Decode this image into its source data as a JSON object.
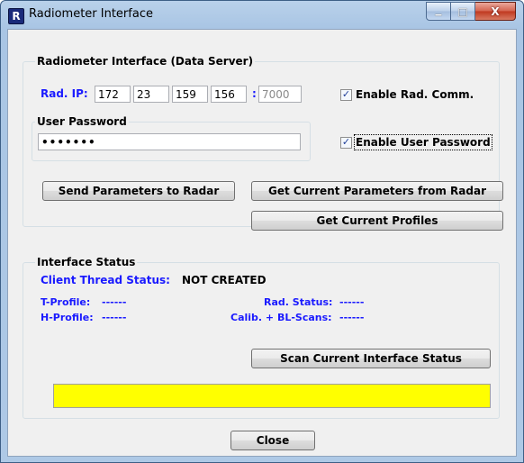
{
  "window": {
    "title": "Radiometer Interface",
    "icon_glyph": "R",
    "minimize_glyph": "▁",
    "maximize_glyph": "□",
    "close_glyph": "X"
  },
  "data_server": {
    "group_title": "Radiometer Interface (Data Server)",
    "ip_label": "Rad. IP:",
    "ip_octets": [
      "172",
      "23",
      "159",
      "156"
    ],
    "port_separator": ":",
    "port": "7000",
    "enable_comm_label": "Enable Rad. Comm.",
    "enable_comm_checked": true,
    "password_group_title": "User Password",
    "password_value": "•••••••",
    "enable_password_label": "Enable User Password",
    "enable_password_checked": true,
    "send_params_label": "Send Parameters to Radar",
    "get_params_label": "Get Current Parameters from Radar",
    "get_profiles_label": "Get Current Profiles"
  },
  "status": {
    "group_title": "Interface Status",
    "client_thread_label": "Client Thread Status:",
    "client_thread_value": "NOT CREATED",
    "t_profile_label": "T-Profile:",
    "t_profile_value": "------",
    "h_profile_label": "H-Profile:",
    "h_profile_value": "------",
    "rad_status_label": "Rad. Status:",
    "rad_status_value": "------",
    "calib_label": "Calib. + BL-Scans:",
    "calib_value": "------",
    "scan_button_label": "Scan Current Interface Status",
    "status_bar_color": "#ffff00"
  },
  "footer": {
    "close_label": "Close"
  }
}
